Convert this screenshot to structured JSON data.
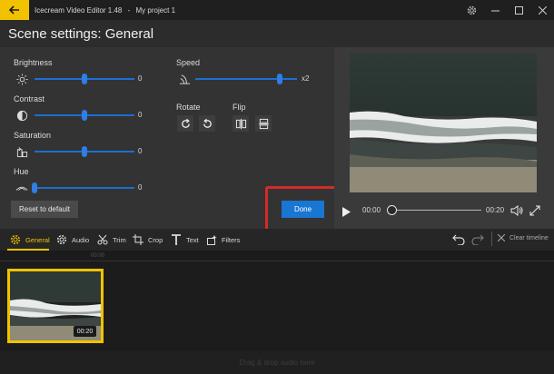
{
  "window": {
    "title": "Icecream Video Editor 1.48",
    "separator": "-",
    "project": "My project 1"
  },
  "header": {
    "title": "Scene settings: General"
  },
  "settings": {
    "brightness": {
      "label": "Brightness",
      "value": "0",
      "level": 0.5,
      "icon": "sun-icon"
    },
    "contrast": {
      "label": "Contrast",
      "value": "0",
      "level": 0.5,
      "icon": "contrast-icon"
    },
    "saturation": {
      "label": "Saturation",
      "value": "0",
      "level": 0.5,
      "icon": "saturation-icon"
    },
    "hue": {
      "label": "Hue",
      "value": "0",
      "level": 0.0,
      "icon": "hue-icon"
    },
    "speed": {
      "label": "Speed",
      "value": "x2",
      "level": 0.83,
      "icon": "speed-icon"
    },
    "rotate": {
      "label": "Rotate"
    },
    "flip": {
      "label": "Flip"
    },
    "reset_label": "Reset to default",
    "done_label": "Done"
  },
  "player": {
    "current_time": "00:00",
    "duration": "00:20",
    "progress": 0.0
  },
  "tabs": [
    {
      "label": "General",
      "icon": "gear-icon",
      "active": true
    },
    {
      "label": "Audio",
      "icon": "audio-icon"
    },
    {
      "label": "Trim",
      "icon": "scissors-icon"
    },
    {
      "label": "Crop",
      "icon": "crop-icon"
    },
    {
      "label": "Text",
      "icon": "text-icon"
    },
    {
      "label": "Filters",
      "icon": "filters-icon"
    }
  ],
  "timeline": {
    "clear_label": "Clear timeline",
    "ruler_label": "00:00",
    "clip_duration": "00:20",
    "audio_hint": "Drag & drop audio here"
  },
  "colors": {
    "accent": "#f2c200",
    "primary_button": "#1976d2",
    "slider": "#2d7ee6",
    "highlight_box": "#d42a2a"
  }
}
